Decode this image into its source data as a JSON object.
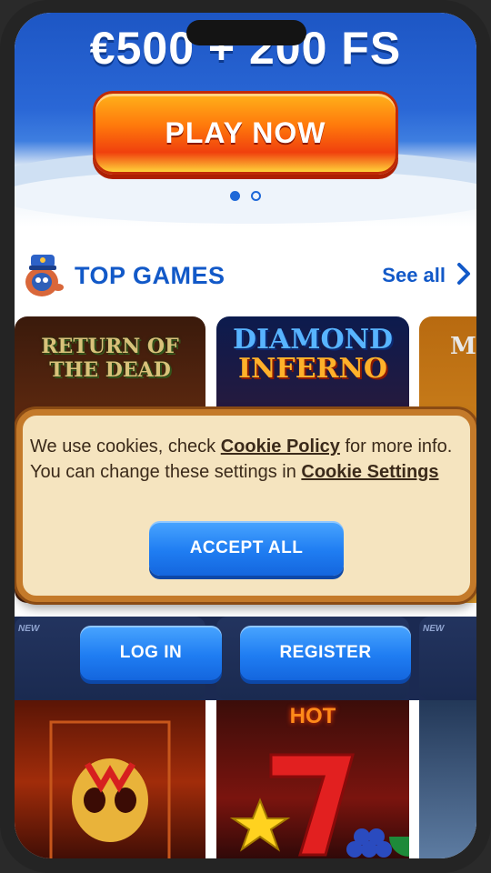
{
  "hero": {
    "title": "€500 + 200 FS",
    "cta_label": "PLAY NOW",
    "carousel_pages": 2,
    "carousel_active": 1
  },
  "top_games": {
    "title": "TOP GAMES",
    "see_all_label": "See all",
    "row1": [
      {
        "title": "RETURN OF THE DEAD"
      },
      {
        "title_line1": "DIAMOND",
        "title_line2": "INFERNO"
      },
      {
        "title": "M"
      }
    ],
    "row2_badge": "NEW",
    "row3": [
      {
        "label": ""
      },
      {
        "label": "HOT"
      },
      {
        "label": ""
      }
    ]
  },
  "auth": {
    "login_label": "LOG IN",
    "register_label": "REGISTER"
  },
  "cookie_banner": {
    "text_before_policy": "We use cookies, check ",
    "policy_link": "Cookie Policy",
    "text_after_policy": " for more info. You can change these settings in ",
    "settings_link": "Cookie Settings",
    "accept_label": "ACCEPT ALL"
  },
  "colors": {
    "brand_blue": "#1259c8",
    "cta_orange": "#ff7a0c",
    "cookie_bg": "#f5e4bf",
    "cookie_border": "#c47a2a"
  }
}
